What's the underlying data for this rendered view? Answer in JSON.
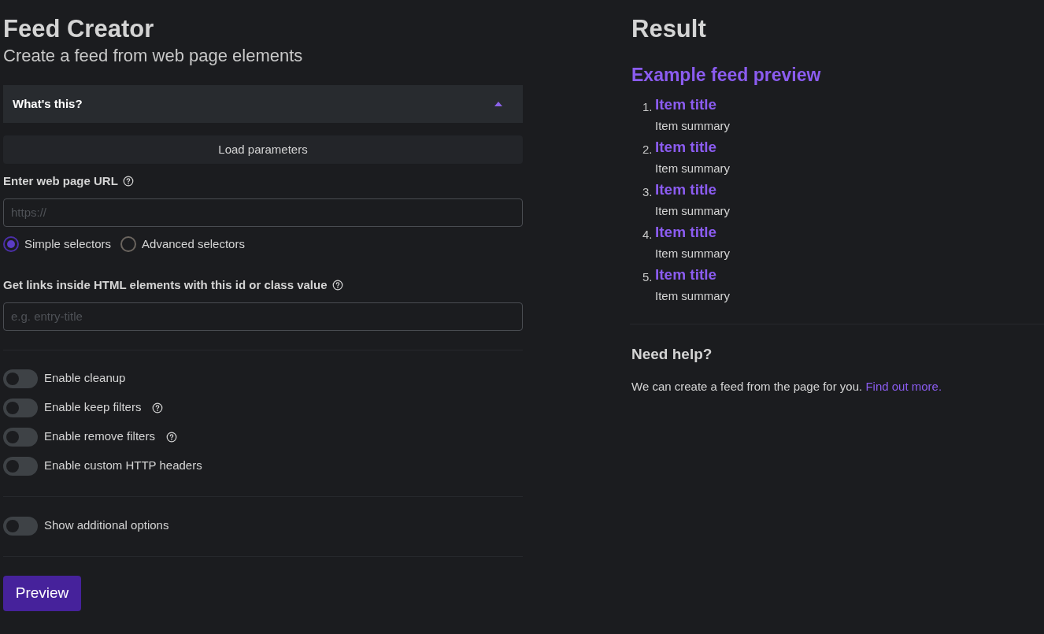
{
  "form": {
    "title": "Feed Creator",
    "subtitle": "Create a feed from web page elements",
    "accordion": {
      "label": "What's this?",
      "expanded": false
    },
    "load_button": "Load parameters",
    "url_field": {
      "label": "Enter web page URL",
      "help": true,
      "placeholder": "https://"
    },
    "selector_modes": [
      {
        "label": "Simple selectors",
        "selected": true
      },
      {
        "label": "Advanced selectors",
        "selected": false
      }
    ],
    "selector_field": {
      "label": "Get links inside HTML elements with this id or class value",
      "help": true,
      "placeholder": "e.g. entry-title"
    },
    "toggles": [
      {
        "label": "Enable cleanup",
        "on": false,
        "help": false
      },
      {
        "label": "Enable keep filters",
        "on": false,
        "help": true
      },
      {
        "label": "Enable remove filters",
        "on": false,
        "help": true
      },
      {
        "label": "Enable custom HTTP headers",
        "on": false,
        "help": false
      }
    ],
    "extra_toggle": {
      "label": "Show additional options",
      "on": false
    },
    "preview_button": "Preview"
  },
  "result": {
    "title": "Result",
    "preview_title": "Example feed preview",
    "items": [
      {
        "number": "1.",
        "title": "Item title",
        "summary": "Item summary"
      },
      {
        "number": "2.",
        "title": "Item title",
        "summary": "Item summary"
      },
      {
        "number": "3.",
        "title": "Item title",
        "summary": "Item summary"
      },
      {
        "number": "4.",
        "title": "Item title",
        "summary": "Item summary"
      },
      {
        "number": "5.",
        "title": "Item title",
        "summary": "Item summary"
      }
    ],
    "help_title": "Need help?",
    "help_text": "We can create a feed from the page for you.",
    "help_link": "Find out more."
  }
}
